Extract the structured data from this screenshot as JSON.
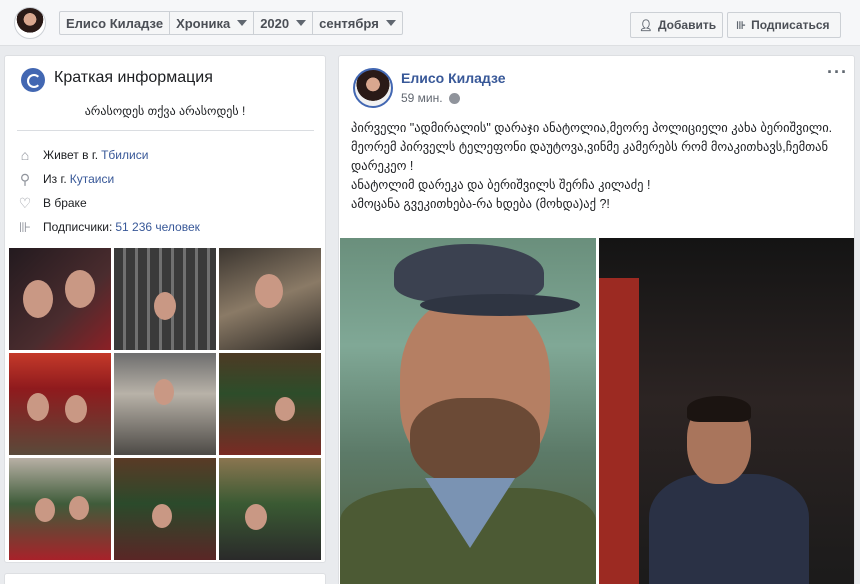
{
  "topbar": {
    "crumbs": [
      "Елисо Киладзе",
      "Хроника",
      "2020",
      "сентября"
    ],
    "add_label": "Добавить",
    "subscribe_label": "Подписаться",
    "add_icon": "add-friend-icon",
    "subscribe_icon": "rss-icon"
  },
  "intro": {
    "title": "Краткая информация",
    "bio": "არასოდეს თქვა არასოდეს !",
    "rows": [
      {
        "icon": "home-icon",
        "text": "Живет в г.",
        "link": "Тбилиси"
      },
      {
        "icon": "location-pin-icon",
        "text": "Из г.",
        "link": "Кутаиси"
      },
      {
        "icon": "heart-icon",
        "text": "В браке",
        "link": ""
      },
      {
        "icon": "rss-icon",
        "text": "Подписчики:",
        "link": "51 236 человек"
      }
    ]
  },
  "post": {
    "author": "Елисо Киладзе",
    "time": "59 мин.",
    "privacy_icon": "public-globe-icon",
    "text": "პირველი \"ადმირალის\" დარაჯი ანატოლია,მეორე პოლიციელი კახა ბერიშვილი.\nმეორემ პირველს ტელეფონი დაუტოვა,ვინმე კამერებს რომ მოაკითხავს,ჩემთან დარეკეო !\nანატოლიმ დარეკა და ბერიშვილს შერჩა კილაძე !\nამოცანა გვეკითხება-რა ხდება (მოხდა)აქ ?!"
  },
  "colors": {
    "link": "#385898",
    "accent": "#4267b2",
    "background": "#e9ebee"
  }
}
